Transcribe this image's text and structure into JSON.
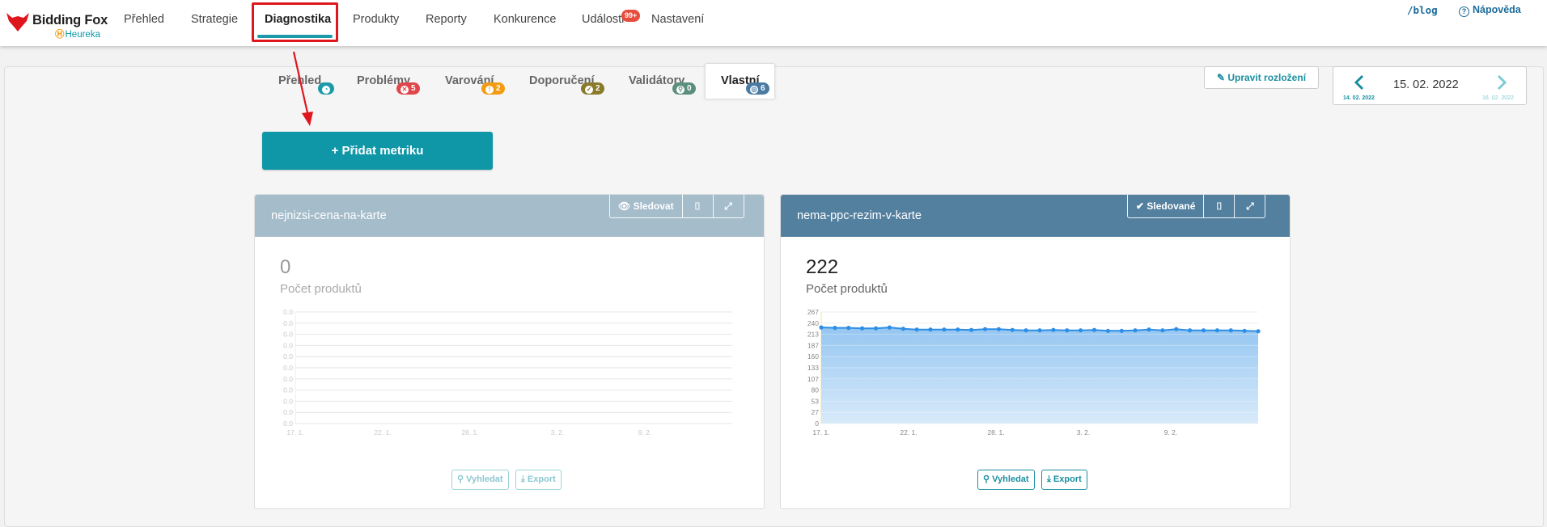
{
  "nav": {
    "brand": "Bidding Fox",
    "brand_sub": "Heureka",
    "items": [
      "Přehled",
      "Strategie",
      "Diagnostika",
      "Produkty",
      "Reporty",
      "Konkurence",
      "Události",
      "Nastavení"
    ],
    "active": "Diagnostika",
    "events_badge": "99+",
    "blog": "/blog",
    "help": "Nápověda"
  },
  "subtabs": {
    "items": [
      {
        "label": "Přehled",
        "badge": "",
        "color": "#1b9aaa"
      },
      {
        "label": "Problémy",
        "badge": "5",
        "color": "#e0474c"
      },
      {
        "label": "Varování",
        "badge": "2",
        "color": "#f39c12"
      },
      {
        "label": "Doporučení",
        "badge": "2",
        "color": "#8a7a2a"
      },
      {
        "label": "Validátory",
        "badge": "0",
        "color": "#5b8f7d"
      },
      {
        "label": "Vlastní",
        "badge": "6",
        "color": "#4b7ba3"
      }
    ],
    "active": "Vlastní"
  },
  "add_metric": "Přidat metriku",
  "edit_layout": "Upravit rozložení",
  "date": {
    "current": "15. 02. 2022",
    "prev": "14. 02. 2022",
    "next": "16. 02. 2022"
  },
  "cards": [
    {
      "title": "nejnizsi-cena-na-karte",
      "follow_label": "Sledovat",
      "value": "0",
      "value_label": "Počet produktů",
      "search_label": "Vyhledat",
      "export_label": "Export",
      "header_color": "#a5bccb"
    },
    {
      "title": "nema-ppc-rezim-v-karte",
      "follow_label": "Sledované",
      "value": "222",
      "value_label": "Počet produktů",
      "search_label": "Vyhledat",
      "export_label": "Export",
      "header_color": "#53809f"
    }
  ],
  "chart_data": [
    {
      "type": "area",
      "title": "",
      "x_ticks": [
        "17. 1.",
        "22. 1.",
        "28. 1.",
        "3. 2.",
        "9. 2."
      ],
      "y_ticks": [
        "0.0",
        "0.0",
        "0.0",
        "0.0",
        "0.0",
        "0.0",
        "0.0",
        "0.0",
        "0.0",
        "0.0",
        "0.0"
      ],
      "values": []
    },
    {
      "type": "area",
      "title": "",
      "x_ticks": [
        "17. 1.",
        "22. 1.",
        "28. 1.",
        "3. 2.",
        "9. 2."
      ],
      "y_ticks": [
        "0",
        "27",
        "53",
        "80",
        "107",
        "133",
        "160",
        "187",
        "213",
        "240",
        "267"
      ],
      "ylim": [
        0,
        267
      ],
      "values": [
        230,
        229,
        229,
        228,
        228,
        230,
        227,
        225,
        225,
        225,
        225,
        224,
        226,
        226,
        224,
        223,
        223,
        224,
        223,
        223,
        224,
        222,
        222,
        223,
        225,
        223,
        226,
        223,
        223,
        223,
        223,
        222,
        221
      ]
    }
  ]
}
